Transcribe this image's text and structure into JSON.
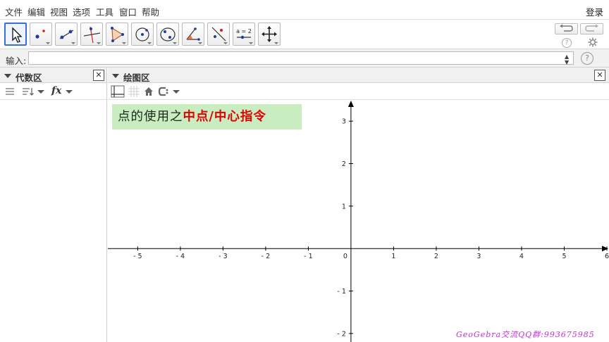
{
  "menu": {
    "items": [
      "文件",
      "编辑",
      "视图",
      "选项",
      "工具",
      "窗口",
      "帮助"
    ],
    "login": "登录"
  },
  "toolbar": {
    "tools": [
      {
        "icon": "move-arrow-icon",
        "active": true
      },
      {
        "icon": "point-icon"
      },
      {
        "icon": "line-icon"
      },
      {
        "icon": "perpendicular-line-icon"
      },
      {
        "icon": "polygon-icon"
      },
      {
        "icon": "circle-center-point-icon"
      },
      {
        "icon": "conic-ellipse-icon"
      },
      {
        "icon": "angle-icon"
      },
      {
        "icon": "reflect-icon"
      },
      {
        "icon": "slider-icon",
        "label": "a = 2"
      },
      {
        "icon": "move-graphics-view-icon"
      }
    ],
    "help_symbol": "?"
  },
  "input_bar": {
    "label": "输入:",
    "value": "",
    "help_symbol": "?"
  },
  "algebra_view": {
    "title": "代数区",
    "fx_label": "fx"
  },
  "graphics_view": {
    "title": "绘图区",
    "caption_prefix": "点的使用之",
    "caption_highlight": "中点/中心指令",
    "watermark": "GeoGebra交流QQ群:993675985",
    "x_ticks": [
      "-5",
      "-4",
      "-3",
      "-2",
      "-1",
      "0",
      "1",
      "2",
      "3",
      "4",
      "5",
      "6"
    ],
    "y_ticks": [
      "3",
      "2",
      "1",
      "-1",
      "-2"
    ],
    "x_range": [
      -5.7,
      6.05
    ],
    "y_range": [
      -2.2,
      3.5
    ]
  },
  "colors": {
    "caption_bg": "#c9ecc0",
    "caption_highlight": "#e00000",
    "watermark": "#c42ed6",
    "active_tool_border": "#3a6fd8"
  }
}
